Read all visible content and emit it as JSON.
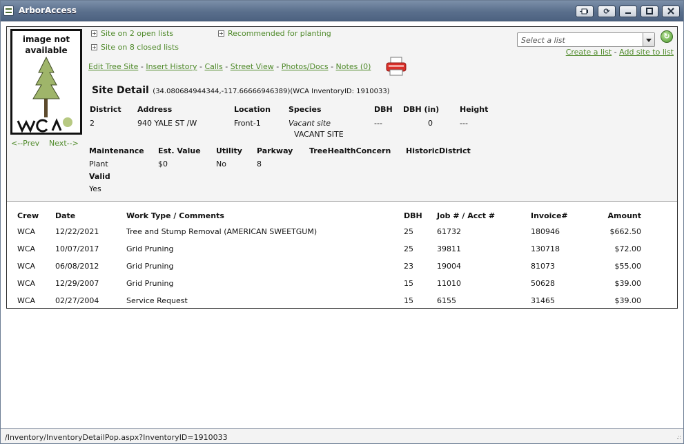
{
  "window": {
    "title": "ArborAccess",
    "buttons": [
      "pin",
      "reload",
      "minimize",
      "maximize",
      "close"
    ]
  },
  "photo": {
    "placeholder": "image not available",
    "logo": "WCA"
  },
  "nav": {
    "prev": "<--Prev",
    "next": "Next-->"
  },
  "lists": {
    "open": "Site on 2 open lists",
    "closed": "Site on 8 closed lists",
    "recommended": "Recommended for planting",
    "select_placeholder": "Select a list",
    "create": "Create a list",
    "add": "Add site to list",
    "dash": "-"
  },
  "actions": [
    "Edit Tree Site",
    "Insert History",
    "Calls",
    "Street View",
    "Photos/Docs",
    "Notes (0)"
  ],
  "site": {
    "title": "Site Detail",
    "coords": "(34.080684944344,-117.66666946389)(WCA InventoryID: 1910033)",
    "headers1": [
      "District",
      "Address",
      "Location",
      "Species",
      "DBH",
      "DBH (in)",
      "Height"
    ],
    "values1": [
      "2",
      "940 YALE ST /W",
      "Front-1",
      "Vacant site",
      "---",
      "0",
      "---"
    ],
    "species_common": "VACANT SITE",
    "headers2": [
      "Maintenance",
      "Est. Value",
      "Utility",
      "Parkway",
      "TreeHealthConcern",
      "HistoricDistrict"
    ],
    "values2": [
      "Plant",
      "$0",
      "No",
      "8",
      "",
      ""
    ],
    "valid_label": "Valid",
    "valid_value": "Yes"
  },
  "history": {
    "columns": [
      "Crew",
      "Date",
      "Work Type / Comments",
      "DBH",
      "Job # / Acct #",
      "Invoice#",
      "Amount"
    ],
    "rows": [
      [
        "WCA",
        "12/22/2021",
        "Tree and Stump Removal (AMERICAN SWEETGUM)",
        "25",
        "61732",
        "180946",
        "$662.50"
      ],
      [
        "WCA",
        "10/07/2017",
        "Grid Pruning",
        "25",
        "39811",
        "130718",
        "$72.00"
      ],
      [
        "WCA",
        "06/08/2012",
        "Grid Pruning",
        "23",
        "19004",
        "81073",
        "$55.00"
      ],
      [
        "WCA",
        "12/29/2007",
        "Grid Pruning",
        "15",
        "11010",
        "50628",
        "$39.00"
      ],
      [
        "WCA",
        "02/27/2004",
        "Service Request",
        "15",
        "6155",
        "31465",
        "$39.00"
      ]
    ]
  },
  "status": {
    "url": "/Inventory/InventoryDetailPop.aspx?InventoryID=1910033"
  },
  "colors": {
    "link": "#4f8a2a",
    "titlebar": "#5a6f8c"
  }
}
